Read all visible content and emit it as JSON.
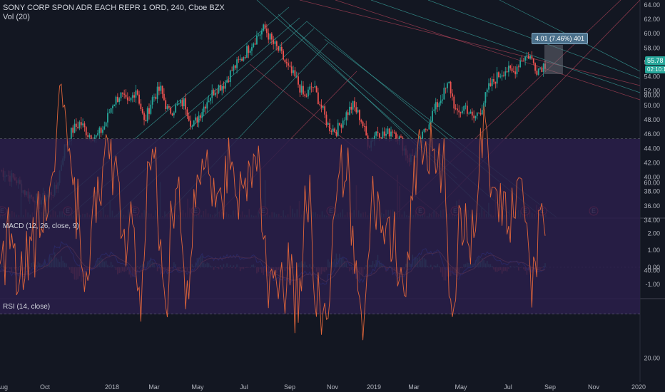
{
  "header": {
    "symbol_title": "SONY CORP SPON ADR EACH REPR 1 ORD, 240, Cboe BZX",
    "volume_label": "Vol (20)"
  },
  "macd_panel": {
    "title": "MACD (12, 26, close, 9)"
  },
  "rsi_panel": {
    "title": "RSI (14, close)"
  },
  "price_tags": {
    "last_price": "55.78",
    "countdown": "02:10:16"
  },
  "measure_label": "4.01 (7.46%) 401",
  "earnings_marker": "E",
  "colors": {
    "background": "#131722",
    "up": "#26a69a",
    "down": "#ef5350",
    "macd_line": "#2962ff",
    "signal_line": "#ef7a6a",
    "rsi_line": "#e0653a",
    "rsi_band": "#2a1f4a",
    "trend_teal": "#3aa6a0",
    "trend_red": "#b5445a"
  },
  "chart_data": [
    {
      "type": "candlestick",
      "title": "SONY CORP SPON ADR EACH REPR 1 ORD, 240, Cboe BZX",
      "x_tick_labels": [
        "Aug",
        "Oct",
        "2018",
        "Mar",
        "May",
        "Jul",
        "Sep",
        "Nov",
        "2019",
        "Mar",
        "May",
        "Jul",
        "Sep",
        "Nov",
        "2020"
      ],
      "y_tick_labels": [
        "34.00",
        "36.00",
        "38.00",
        "40.00",
        "42.00",
        "44.00",
        "46.00",
        "48.00",
        "50.00",
        "52.00",
        "54.00",
        "56.00",
        "58.00",
        "60.00",
        "62.00",
        "64.00"
      ],
      "ylim": [
        34,
        64
      ],
      "close_path": [
        [
          "Aug",
          41.0
        ],
        [
          "Aug",
          40.2
        ],
        [
          "Sep",
          39.6
        ],
        [
          "Sep",
          38.0
        ],
        [
          "Oct",
          37.2
        ],
        [
          "Oct",
          36.8
        ],
        [
          "Oct",
          37.5
        ],
        [
          "Oct",
          38.3
        ],
        [
          "Nov",
          44.0
        ],
        [
          "Nov",
          46.5
        ],
        [
          "Dec",
          47.6
        ],
        [
          "Dec",
          46.0
        ],
        [
          "Dec",
          45.6
        ],
        [
          "2018",
          47.0
        ],
        [
          "2018",
          50.2
        ],
        [
          "Jan",
          51.5
        ],
        [
          "Feb",
          50.0
        ],
        [
          "Feb",
          52.5
        ],
        [
          "Feb",
          47.5
        ],
        [
          "Mar",
          51.0
        ],
        [
          "Mar",
          52.3
        ],
        [
          "Apr",
          49.0
        ],
        [
          "Apr",
          49.8
        ],
        [
          "Apr",
          50.5
        ],
        [
          "May",
          47.0
        ],
        [
          "May",
          49.0
        ],
        [
          "Jun",
          51.0
        ],
        [
          "Jun",
          52.5
        ],
        [
          "Jul",
          53.0
        ],
        [
          "Jul",
          55.0
        ],
        [
          "Aug",
          56.3
        ],
        [
          "Aug",
          58.0
        ],
        [
          "Sep",
          59.5
        ],
        [
          "Sep",
          60.8
        ],
        [
          "Sep",
          58.7
        ],
        [
          "Oct",
          57.3
        ],
        [
          "Oct",
          55.0
        ],
        [
          "Oct",
          53.5
        ],
        [
          "Nov",
          51.0
        ],
        [
          "Nov",
          52.8
        ],
        [
          "Dec",
          50.0
        ],
        [
          "Dec",
          47.0
        ],
        [
          "Dec",
          46.5
        ],
        [
          "2019",
          48.5
        ],
        [
          "2019",
          50.0
        ],
        [
          "Jan",
          48.2
        ],
        [
          "Feb",
          44.5
        ],
        [
          "Feb",
          46.5
        ],
        [
          "Mar",
          45.8
        ],
        [
          "Mar",
          46.7
        ],
        [
          "Mar",
          45.0
        ],
        [
          "Apr",
          42.5
        ],
        [
          "Apr",
          43.5
        ],
        [
          "Apr",
          46.5
        ],
        [
          "May",
          49.0
        ],
        [
          "May",
          51.0
        ],
        [
          "May",
          53.0
        ],
        [
          "Jun",
          48.5
        ],
        [
          "Jun",
          50.0
        ],
        [
          "Jun",
          48.0
        ],
        [
          "Jul",
          49.5
        ],
        [
          "Jul",
          52.5
        ],
        [
          "Jul",
          54.0
        ],
        [
          "Aug",
          55.0
        ],
        [
          "Aug",
          54.5
        ],
        [
          "Aug",
          56.5
        ],
        [
          "Aug",
          57.0
        ],
        [
          "Aug",
          55.0
        ],
        [
          "Sep",
          55.78
        ]
      ]
    },
    {
      "type": "bar",
      "name": "Vol (20)",
      "note_values": "relative volume, spikes around earnings dates"
    },
    {
      "type": "line",
      "title": "MACD (12, 26, close, 9)",
      "y_tick_labels": [
        "-1.00",
        "0.00",
        "1.00",
        "2.00"
      ],
      "ylim": [
        -1.2,
        2.1
      ]
    },
    {
      "type": "line",
      "title": "RSI (14, close)",
      "y_tick_labels": [
        "20.00",
        "40.00",
        "60.00",
        "80.00"
      ],
      "ylim": [
        15,
        90
      ],
      "band": [
        30,
        70
      ]
    }
  ]
}
